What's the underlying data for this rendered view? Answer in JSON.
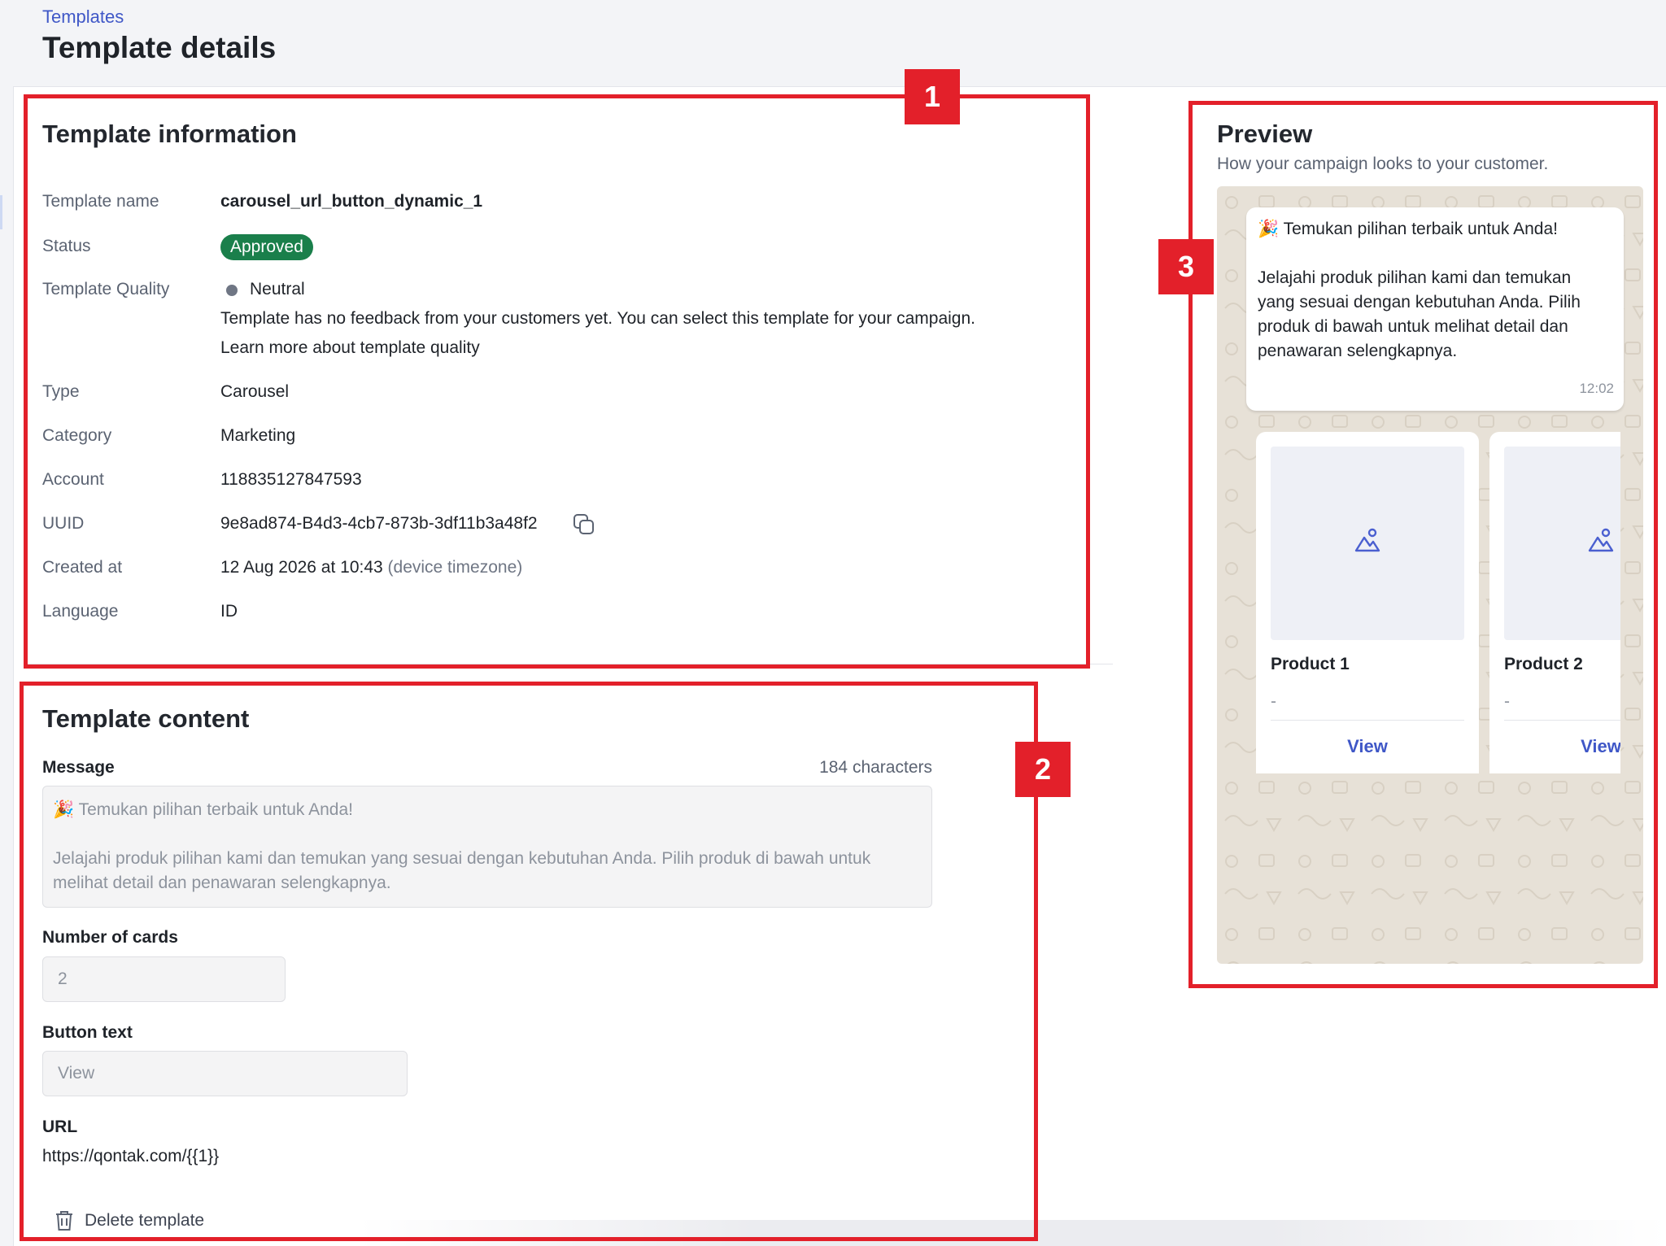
{
  "breadcrumb": "Templates",
  "page_title": "Template details",
  "info": {
    "title": "Template information",
    "rows": {
      "name": {
        "label": "Template name",
        "value": "carousel_url_button_dynamic_1"
      },
      "status": {
        "label": "Status",
        "value": "Approved"
      },
      "quality": {
        "label": "Template Quality",
        "value": "Neutral",
        "note": "Template has no feedback from your customers yet. You can select this template for your campaign.",
        "link": "Learn more about template quality"
      },
      "type": {
        "label": "Type",
        "value": "Carousel"
      },
      "category": {
        "label": "Category",
        "value": "Marketing"
      },
      "account": {
        "label": "Account",
        "value": "118835127847593"
      },
      "uuid": {
        "label": "UUID",
        "value": "9e8ad874-B4d3-4cb7-873b-3df11b3a48f2"
      },
      "created": {
        "label": "Created at",
        "value": "12 Aug 2026 at 10:43",
        "suffix": "(device timezone)"
      },
      "language": {
        "label": "Language",
        "value": "ID"
      }
    }
  },
  "content": {
    "title": "Template content",
    "message_label": "Message",
    "char_count": "184 characters",
    "message": "🎉 Temukan pilihan terbaik untuk Anda!\n\nJelajahi produk pilihan kami dan temukan yang sesuai dengan kebutuhan Anda. Pilih produk di bawah untuk melihat detail dan penawaran selengkapnya.",
    "cards_label": "Number of cards",
    "cards_value": "2",
    "button_label": "Button text",
    "button_value": "View",
    "url_label": "URL",
    "url_value": "https://qontak.com/{{1}}",
    "delete_label": "Delete template"
  },
  "preview": {
    "title": "Preview",
    "subtitle": "How your campaign looks to your customer.",
    "message": "🎉 Temukan pilihan terbaik untuk Anda!\n\nJelajahi produk pilihan kami dan temukan yang sesuai dengan kebutuhan Anda. Pilih produk di bawah untuk melihat detail dan penawaran selengkapnya.",
    "time": "12:02",
    "cards": [
      {
        "title": "Product 1",
        "desc": "-",
        "button": "View"
      },
      {
        "title": "Product 2",
        "desc": "-",
        "button": "View"
      }
    ]
  },
  "annotations": [
    "1",
    "2",
    "3"
  ],
  "colors": {
    "accent": "#3f57c7",
    "approved": "#1a7f4b",
    "annotation": "#e3202a",
    "chat_background": "#e7e1d7"
  },
  "icons": {
    "copy": "copy-icon",
    "trash": "trash-icon",
    "image_placeholder": "image-icon"
  }
}
